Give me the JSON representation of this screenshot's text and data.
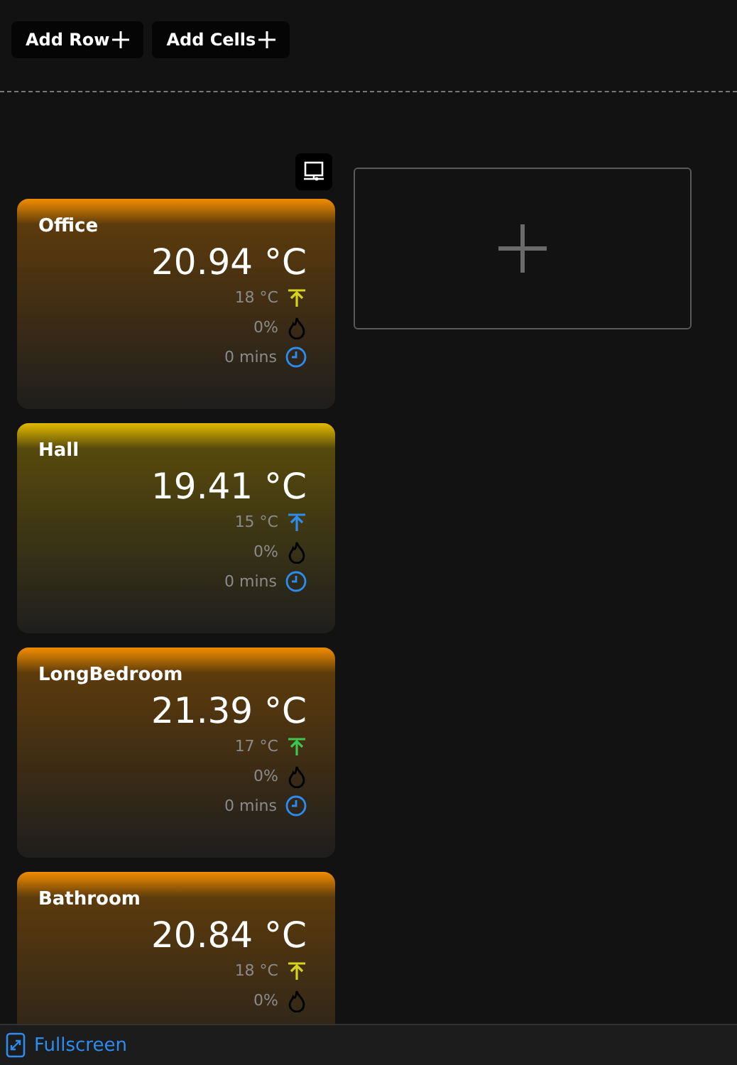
{
  "toolbar": {
    "buttons": [
      {
        "label": "Add Row"
      },
      {
        "label": "Add Cells"
      }
    ]
  },
  "rooms": [
    {
      "name": "Office",
      "temperature": "20.94 °C",
      "color": "#f08c00",
      "setpoint": {
        "text": "18 °C",
        "color": "#d4d41c"
      },
      "heating": "0%",
      "time": "0 mins"
    },
    {
      "name": "Hall",
      "temperature": "19.41 °C",
      "color": "#e0b800",
      "setpoint": {
        "text": "15 °C",
        "color": "#2d8cf0"
      },
      "heating": "0%",
      "time": "0 mins"
    },
    {
      "name": "LongBedroom",
      "temperature": "21.39 °C",
      "color": "#f08c00",
      "setpoint": {
        "text": "17 °C",
        "color": "#3cc850"
      },
      "heating": "0%",
      "time": "0 mins"
    },
    {
      "name": "Bathroom",
      "temperature": "20.84 °C",
      "color": "#f08c00",
      "setpoint": {
        "text": "18 °C",
        "color": "#d4d41c"
      },
      "heating": "0%"
    }
  ],
  "footer": {
    "link": "Fullscreen"
  }
}
